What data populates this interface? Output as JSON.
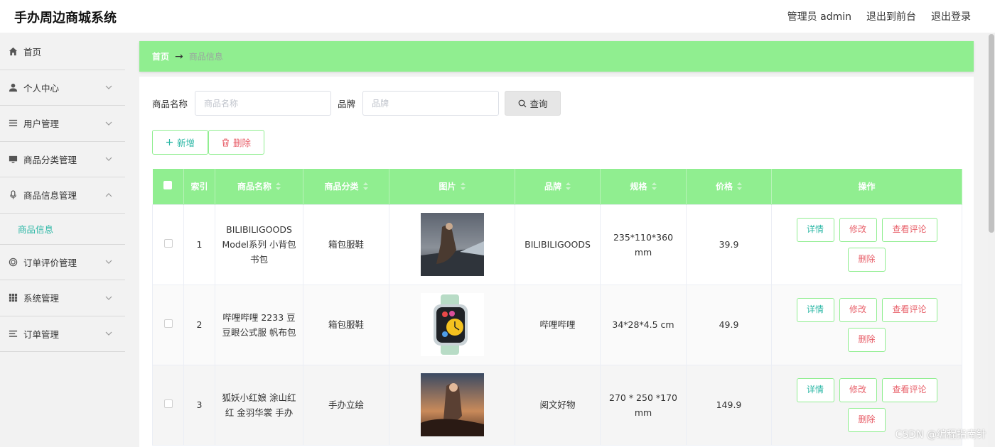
{
  "header": {
    "app_title": "手办周边商城系统",
    "user": "管理员 admin",
    "to_front": "退出到前台",
    "logout": "退出登录"
  },
  "sidebar": {
    "items": [
      {
        "label": "首页",
        "icon": "home-icon"
      },
      {
        "label": "个人中心",
        "icon": "user-icon"
      },
      {
        "label": "用户管理",
        "icon": "list-icon"
      },
      {
        "label": "商品分类管理",
        "icon": "monitor-icon"
      },
      {
        "label": "商品信息管理",
        "icon": "microphone-icon"
      },
      {
        "label": "订单评价管理",
        "icon": "ring-icon"
      },
      {
        "label": "系统管理",
        "icon": "grid-icon"
      },
      {
        "label": "订单管理",
        "icon": "list-icon"
      }
    ],
    "submenu_active": "商品信息"
  },
  "breadcrumb": {
    "home": "首页",
    "arrow": "→",
    "current": "商品信息"
  },
  "search": {
    "name_label": "商品名称",
    "name_placeholder": "商品名称",
    "brand_label": "品牌",
    "brand_placeholder": "品牌",
    "query_label": "查询"
  },
  "actions": {
    "add_label": "新增",
    "delete_label": "删除"
  },
  "table": {
    "columns": [
      "索引",
      "商品名称",
      "商品分类",
      "图片",
      "品牌",
      "规格",
      "价格",
      "操作"
    ],
    "rows": [
      {
        "index": "1",
        "name": "BILIBILIGOODS Model系列 小背包书包",
        "category": "箱包服鞋",
        "brand": "BILIBILIGOODS",
        "spec": "235*110*360 mm",
        "price": "39.9"
      },
      {
        "index": "2",
        "name": "哔哩哔哩 2233 豆豆眼公式服 帆布包",
        "category": "箱包服鞋",
        "brand": "哔哩哔哩",
        "spec": "34*28*4.5 cm",
        "price": "49.9"
      },
      {
        "index": "3",
        "name": "狐妖小红娘 涂山红红 金羽华裳 手办",
        "category": "手办立绘",
        "brand": "阅文好物",
        "spec": "270 * 250 *170 mm",
        "price": "149.9"
      }
    ],
    "ops": {
      "detail": "详情",
      "edit": "修改",
      "review": "查看评论",
      "delete": "删除"
    }
  },
  "watermark": "CSDN @编程指南针",
  "colors": {
    "accent_green": "#90ee90",
    "teal_text": "#2bb7a5",
    "pink_text": "#e8606a"
  }
}
